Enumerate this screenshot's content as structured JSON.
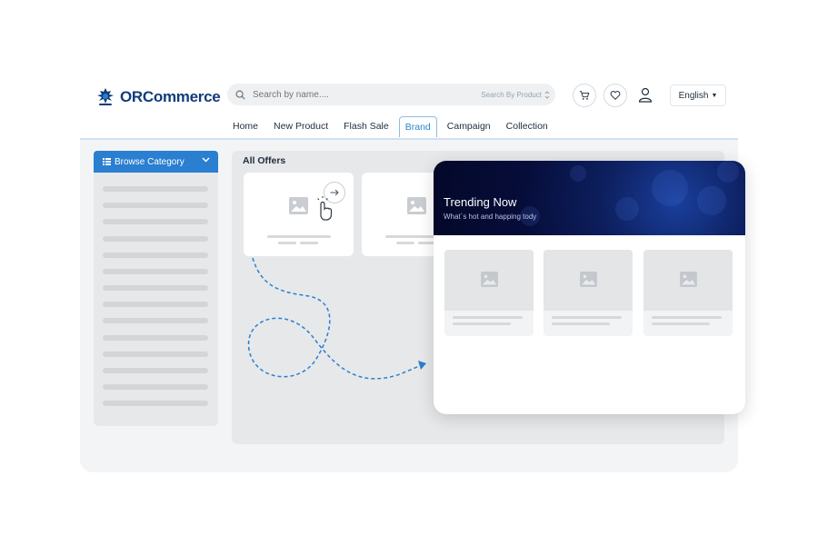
{
  "brand": {
    "name": "ORCommerce",
    "accent": "#2a7fd0",
    "dark": "#123c7a"
  },
  "search": {
    "placeholder": "Search by name....",
    "scope_label": "Search By Product"
  },
  "header": {
    "cart_icon": "cart-icon",
    "wishlist_icon": "heart-icon",
    "account_icon": "user-icon",
    "language": "English"
  },
  "nav": {
    "tabs": [
      {
        "label": "Home"
      },
      {
        "label": "New Product"
      },
      {
        "label": "Flash Sale"
      },
      {
        "label": "Brand",
        "active": true
      },
      {
        "label": "Campaign"
      },
      {
        "label": "Collection"
      }
    ]
  },
  "sidebar": {
    "category_label": "Browse Category"
  },
  "offers": {
    "title": "All Offers"
  },
  "trending": {
    "title": "Trending Now",
    "subtitle": "What`s hot and happing tody"
  }
}
